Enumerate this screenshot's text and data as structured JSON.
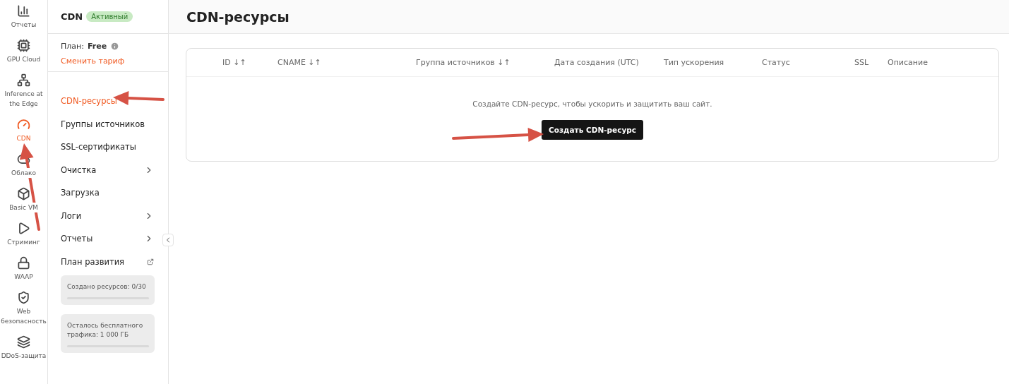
{
  "rail": [
    {
      "label": "Отчеты",
      "selected": false
    },
    {
      "label": "GPU Cloud",
      "selected": false
    },
    {
      "label": "Inference at the Edge",
      "selected": false
    },
    {
      "label": "CDN",
      "selected": true
    },
    {
      "label": "Облако",
      "selected": false
    },
    {
      "label": "Basic VM",
      "selected": false
    },
    {
      "label": "Стриминг",
      "selected": false
    },
    {
      "label": "WAAP",
      "selected": false
    },
    {
      "label": "Web безопасность",
      "selected": false
    },
    {
      "label": "DDoS-защита",
      "selected": false
    }
  ],
  "sidebar": {
    "title": "CDN",
    "badge": "Активный",
    "plan_label": "План:",
    "plan_value": "Free",
    "change_plan": "Сменить тариф",
    "items": [
      {
        "label": "CDN-ресурсы",
        "selected": true,
        "kind": "plain"
      },
      {
        "label": "Группы источников",
        "selected": false,
        "kind": "plain"
      },
      {
        "label": "SSL-сертификаты",
        "selected": false,
        "kind": "plain"
      },
      {
        "label": "Очистка",
        "selected": false,
        "kind": "submenu"
      },
      {
        "label": "Загрузка",
        "selected": false,
        "kind": "plain"
      },
      {
        "label": "Логи",
        "selected": false,
        "kind": "submenu"
      },
      {
        "label": "Отчеты",
        "selected": false,
        "kind": "submenu"
      },
      {
        "label": "План развития",
        "selected": false,
        "kind": "external"
      }
    ],
    "meters": [
      {
        "label": "Создано ресурсов: 0/30"
      },
      {
        "label": "Осталось бесплатного трафика: 1 000 ГБ"
      }
    ]
  },
  "page": {
    "title": "CDN-ресурсы"
  },
  "table": {
    "columns": [
      "ID ↓↑",
      "CNAME ↓↑",
      "Группа источников ↓↑",
      "Дата создания (UTC)",
      "Тип ускорения",
      "Статус",
      "SSL",
      "Описание"
    ],
    "empty_text": "Создайте CDN-ресурс, чтобы ускорить и защитить ваш сайт.",
    "create_button": "Создать CDN-ресурс"
  }
}
